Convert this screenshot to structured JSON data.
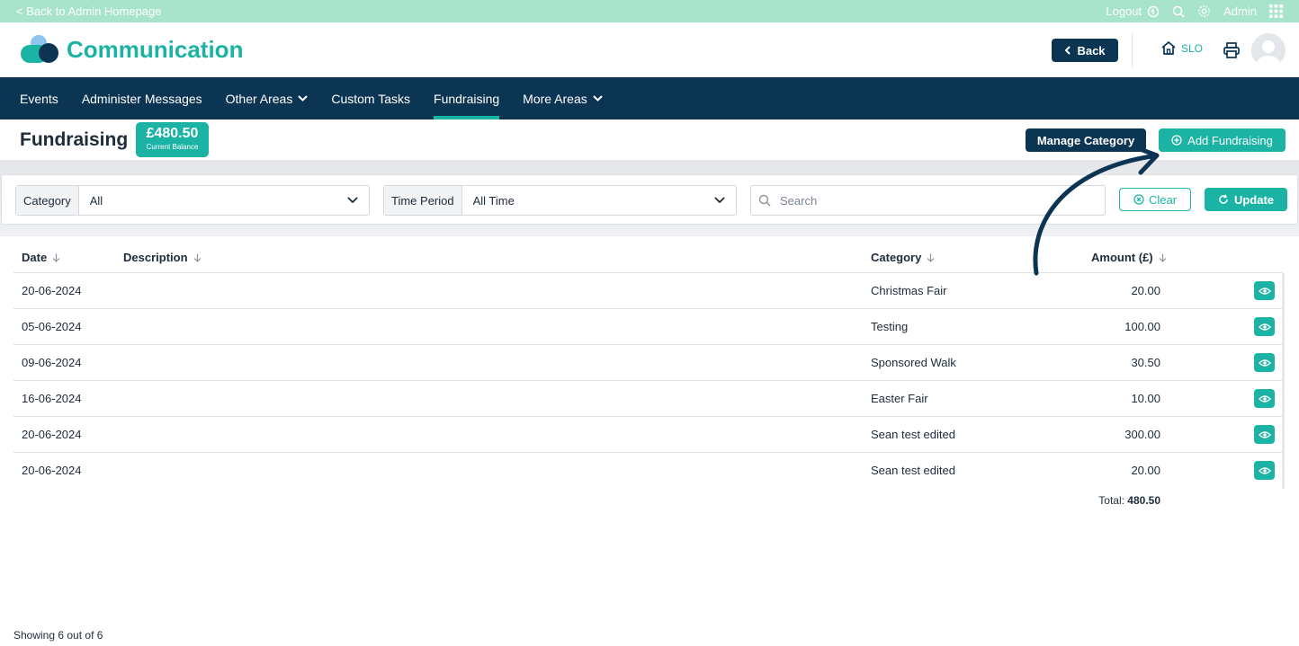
{
  "topbar": {
    "back_label": "< Back to Admin Homepage",
    "logout_label": "Logout",
    "user_label": "Admin"
  },
  "header": {
    "brand": "Communication",
    "back_button": "Back",
    "school_code": "SLO"
  },
  "nav": {
    "items": [
      {
        "label": "Events",
        "dropdown": false
      },
      {
        "label": "Administer Messages",
        "dropdown": false
      },
      {
        "label": "Other Areas",
        "dropdown": true
      },
      {
        "label": "Custom Tasks",
        "dropdown": false
      },
      {
        "label": "Fundraising",
        "dropdown": false,
        "active": true
      },
      {
        "label": "More Areas",
        "dropdown": true
      }
    ]
  },
  "page": {
    "title": "Fundraising",
    "balance_amount": "£480.50",
    "balance_label": "Current Balance",
    "manage_category_label": "Manage Category",
    "add_fundraising_label": "Add Fundraising"
  },
  "filters": {
    "category_label": "Category",
    "category_value": "All",
    "time_period_label": "Time Period",
    "time_period_value": "All Time",
    "search_placeholder": "Search",
    "clear_label": "Clear",
    "update_label": "Update"
  },
  "table": {
    "headers": {
      "date": "Date",
      "description": "Description",
      "category": "Category",
      "amount": "Amount (£)"
    },
    "rows": [
      {
        "date": "20-06-2024",
        "description": "",
        "category": "Christmas Fair",
        "amount": "20.00"
      },
      {
        "date": "05-06-2024",
        "description": "",
        "category": "Testing",
        "amount": "100.00"
      },
      {
        "date": "09-06-2024",
        "description": "",
        "category": "Sponsored Walk",
        "amount": "30.50"
      },
      {
        "date": "16-06-2024",
        "description": "",
        "category": "Easter Fair",
        "amount": "10.00"
      },
      {
        "date": "20-06-2024",
        "description": "",
        "category": "Sean test edited",
        "amount": "300.00"
      },
      {
        "date": "20-06-2024",
        "description": "",
        "category": "Sean test edited",
        "amount": "20.00"
      }
    ],
    "total_label": "Total:",
    "total_value": "480.50"
  },
  "footer": {
    "showing": "Showing 6 out of 6"
  },
  "colors": {
    "primary_navy": "#0b3553",
    "accent_teal": "#1bb3a4",
    "topbar_mint": "#a8e4cc"
  }
}
